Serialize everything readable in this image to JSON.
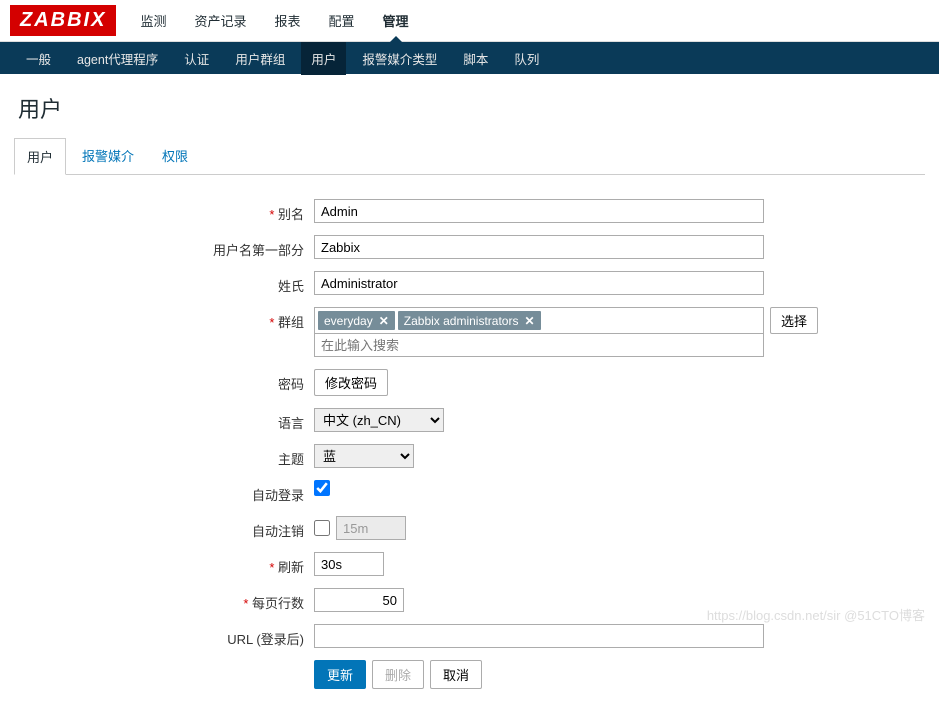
{
  "logo": "ZABBIX",
  "mainNav": [
    "监测",
    "资产记录",
    "报表",
    "配置",
    "管理"
  ],
  "subNav": [
    "一般",
    "agent代理程序",
    "认证",
    "用户群组",
    "用户",
    "报警媒介类型",
    "脚本",
    "队列"
  ],
  "pageTitle": "用户",
  "tabs": [
    "用户",
    "报警媒介",
    "权限"
  ],
  "labels": {
    "alias": "别名",
    "name": "用户名第一部分",
    "surname": "姓氏",
    "groups": "群组",
    "password": "密码",
    "lang": "语言",
    "theme": "主题",
    "autologin": "自动登录",
    "autologout": "自动注销",
    "refresh": "刷新",
    "rows": "每页行数",
    "url": "URL (登录后)"
  },
  "values": {
    "alias": "Admin",
    "name": "Zabbix",
    "surname": "Administrator",
    "autologoutDur": "15m",
    "refresh": "30s",
    "rows": "50",
    "url": ""
  },
  "groupChips": [
    "everyday",
    "Zabbix administrators"
  ],
  "groupSearchPlaceholder": "在此输入搜索",
  "langOptions": "中文 (zh_CN)",
  "themeOptions": "蓝",
  "buttons": {
    "select": "选择",
    "changePw": "修改密码",
    "update": "更新",
    "delete": "删除",
    "cancel": "取消"
  },
  "watermark": "https://blog.csdn.net/sir @51CTO博客"
}
